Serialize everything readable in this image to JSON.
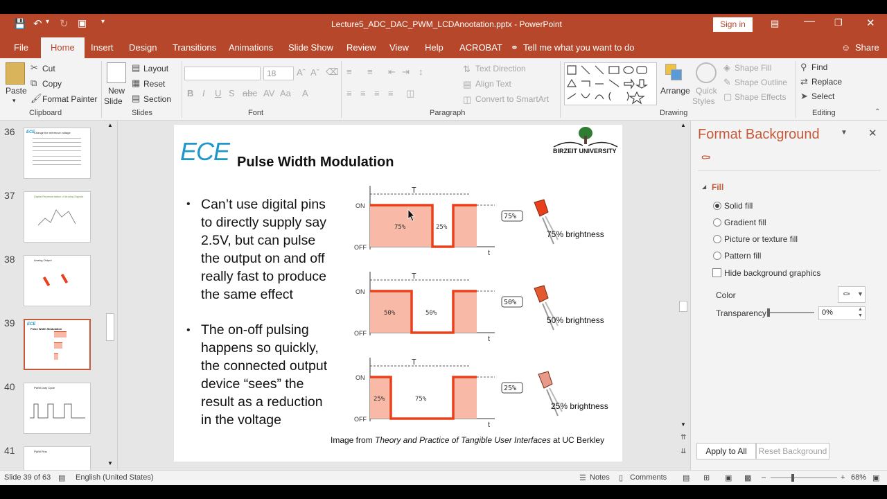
{
  "titlebar": {
    "title": "Lecture5_ADC_DAC_PWM_LCDAnootation.pptx  -  PowerPoint",
    "sign_in": "Sign in"
  },
  "tabs": [
    "File",
    "Home",
    "Insert",
    "Design",
    "Transitions",
    "Animations",
    "Slide Show",
    "Review",
    "View",
    "Help",
    "ACROBAT"
  ],
  "tell_me": "Tell me what you want to do",
  "share": "Share",
  "ribbon": {
    "clipboard": {
      "paste": "Paste",
      "cut": "Cut",
      "copy": "Copy",
      "format_painter": "Format Painter",
      "label": "Clipboard"
    },
    "slides": {
      "new_slide_1": "New",
      "new_slide_2": "Slide",
      "layout": "Layout",
      "reset": "Reset",
      "section": "Section",
      "label": "Slides"
    },
    "font": {
      "size": "18",
      "label": "Font"
    },
    "paragraph": {
      "text_direction": "Text Direction",
      "align_text": "Align Text",
      "smartart": "Convert to SmartArt",
      "label": "Paragraph"
    },
    "drawing": {
      "arrange": "Arrange",
      "quick_styles_1": "Quick",
      "quick_styles_2": "Styles",
      "shape_fill": "Shape Fill",
      "shape_outline": "Shape Outline",
      "shape_effects": "Shape Effects",
      "label": "Drawing"
    },
    "editing": {
      "find": "Find",
      "replace": "Replace",
      "select": "Select",
      "label": "Editing"
    }
  },
  "thumbnails": [
    {
      "num": "36",
      "title": "Change the reference voltage"
    },
    {
      "num": "37",
      "title": "Digital Representation of Analog Signals"
    },
    {
      "num": "38",
      "title": "Analog Output"
    },
    {
      "num": "39",
      "title": "Pulse Width Modulation"
    },
    {
      "num": "40",
      "title": "PWM Duty Cycle"
    },
    {
      "num": "41",
      "title": "PWM Pins"
    }
  ],
  "slide": {
    "logo": "ECE",
    "university": "BIRZEIT UNIVERSITY",
    "title": "Pulse Width Modulation",
    "bullet1": [
      "Can’t use digital pins",
      "to directly supply say",
      "2.5V, but can pulse",
      "the output on and off",
      "really fast to produce",
      "the same effect"
    ],
    "bullet2": [
      "The on-off pulsing",
      "happens so quickly,",
      "the connected output",
      "device “sees” the",
      "result as a reduction",
      "in the voltage"
    ],
    "caption_prefix": "Image from ",
    "caption_italic": "Theory and Practice of Tangible User Interfaces",
    "caption_suffix": " at UC Berkley",
    "waveforms": [
      {
        "duty": 75,
        "on_label": "75%",
        "off_label": "25%",
        "badge": "75%",
        "brightness": "75% brightness"
      },
      {
        "duty": 50,
        "on_label": "50%",
        "off_label": "50%",
        "badge": "50%",
        "brightness": "50% brightness"
      },
      {
        "duty": 25,
        "on_label": "25%",
        "off_label": "75%",
        "badge": "25%",
        "brightness": "25% brightness"
      }
    ],
    "wave_on": "ON",
    "wave_off": "OFF",
    "wave_t": "T",
    "wave_time": "t"
  },
  "format_pane": {
    "title": "Format Background",
    "section": "Fill",
    "options": [
      "Solid fill",
      "Gradient fill",
      "Picture or texture fill",
      "Pattern fill"
    ],
    "selected": "Solid fill",
    "hide_bg": "Hide background graphics",
    "color": "Color",
    "transparency": "Transparency",
    "transparency_value": "0%",
    "transparency_level": 0,
    "apply_all": "Apply to All",
    "reset_bg": "Reset Background"
  },
  "status": {
    "slide_info": "Slide 39 of 63",
    "language": "English (United States)",
    "notes": "Notes",
    "comments": "Comments",
    "zoom": "68%"
  },
  "colors": {
    "accent": "#b7472a",
    "wave_red": "#e8401c",
    "wave_fill": "#f8b9a6",
    "ece_blue": "#1f97c9"
  }
}
